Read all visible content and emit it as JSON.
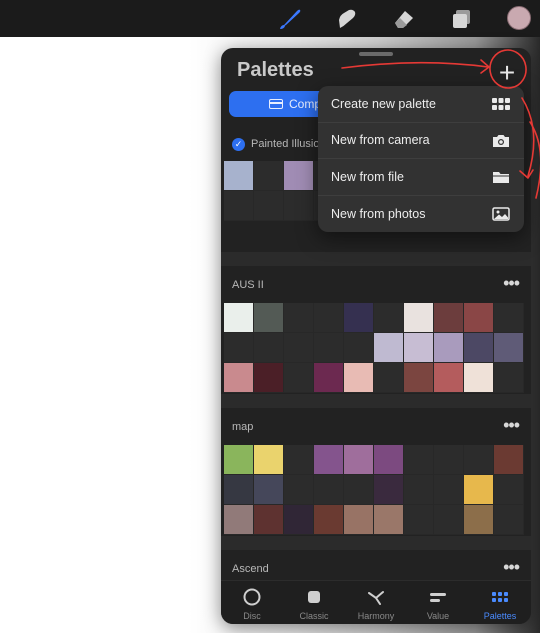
{
  "colors": {
    "accent": "#2d6ff0",
    "tab_active": "#4a8bff",
    "annotation": "#e53935"
  },
  "toolbar": {
    "tools": [
      "brush-icon",
      "smudge-icon",
      "eraser-icon",
      "layers-icon"
    ],
    "avatar": "color-swatch"
  },
  "panel": {
    "title": "Palettes",
    "segment_label": "Comp",
    "menu": {
      "items": [
        {
          "label": "Create new palette",
          "icon": "grid-icon"
        },
        {
          "label": "New from camera",
          "icon": "camera-icon"
        },
        {
          "label": "New from file",
          "icon": "folder-icon"
        },
        {
          "label": "New from photos",
          "icon": "photo-icon"
        }
      ]
    },
    "palettes": [
      {
        "name": "Painted Illusio",
        "checked": true,
        "more": "",
        "rows": [
          [
            "#a7b2cd",
            "#2c2c2c",
            "#a08cb4",
            "#2c2c2c",
            "#2c2c2c",
            "#2c2c2c",
            "#2c2c2c",
            "#2c2c2c",
            "#2c2c2c",
            "#2c2c2c"
          ],
          [
            "#2c2c2c",
            "#2c2c2c",
            "#2c2c2c",
            "#2c2c2c",
            "#2c2c2c",
            "#2c2c2c",
            "#2c2c2c",
            "#2c2c2c",
            "#2c2c2c",
            "#2c2c2c"
          ]
        ]
      },
      {
        "name": "AUS II",
        "checked": false,
        "more": "•••",
        "rows": [
          [
            "#eaefeb",
            "#535a55",
            "#2c2c2c",
            "#2c2c2c",
            "#353050",
            "#2c2c2c",
            "#e9e2df",
            "#6c3d3d",
            "#8a4646",
            "#2c2c2c"
          ],
          [
            "#2c2c2c",
            "#2c2c2c",
            "#2c2c2c",
            "#2c2c2c",
            "#2c2c2c",
            "#bfbad1",
            "#c7bdd3",
            "#a99bbd",
            "#4c4864",
            "#5f5b77"
          ],
          [
            "#c98a8e",
            "#4b1f27",
            "#2c2c2c",
            "#6c2950",
            "#e8bbb4",
            "#2c2c2c",
            "#7b4540",
            "#b45c5d",
            "#efe1d8",
            "#2c2c2c"
          ]
        ]
      },
      {
        "name": "map",
        "checked": false,
        "more": "•••",
        "rows": [
          [
            "#8ab55c",
            "#ead36d",
            "#2c2c2c",
            "#84548d",
            "#9f6e9c",
            "#7c4a80",
            "#2c2c2c",
            "#2c2c2c",
            "#2c2c2c",
            "#6b3a32"
          ],
          [
            "#363842",
            "#45475a",
            "#2c2c2c",
            "#2c2c2c",
            "#2c2c2c",
            "#3a2a3e",
            "#2c2c2c",
            "#2c2c2c",
            "#e7b84c",
            "#2c2c2c"
          ],
          [
            "#917a79",
            "#5e3230",
            "#302636",
            "#6a3a31",
            "#987365",
            "#9a7769",
            "#2c2c2c",
            "#2c2c2c",
            "#8c6e4a",
            "#2c2c2c"
          ]
        ]
      },
      {
        "name": "Ascend",
        "checked": false,
        "more": "•••",
        "rows": []
      }
    ],
    "tabs": [
      {
        "label": "Disc",
        "icon": "disc-icon",
        "active": false
      },
      {
        "label": "Classic",
        "icon": "classic-icon",
        "active": false
      },
      {
        "label": "Harmony",
        "icon": "harmony-icon",
        "active": false
      },
      {
        "label": "Value",
        "icon": "value-icon",
        "active": false
      },
      {
        "label": "Palettes",
        "icon": "palettes-icon",
        "active": true
      }
    ]
  }
}
